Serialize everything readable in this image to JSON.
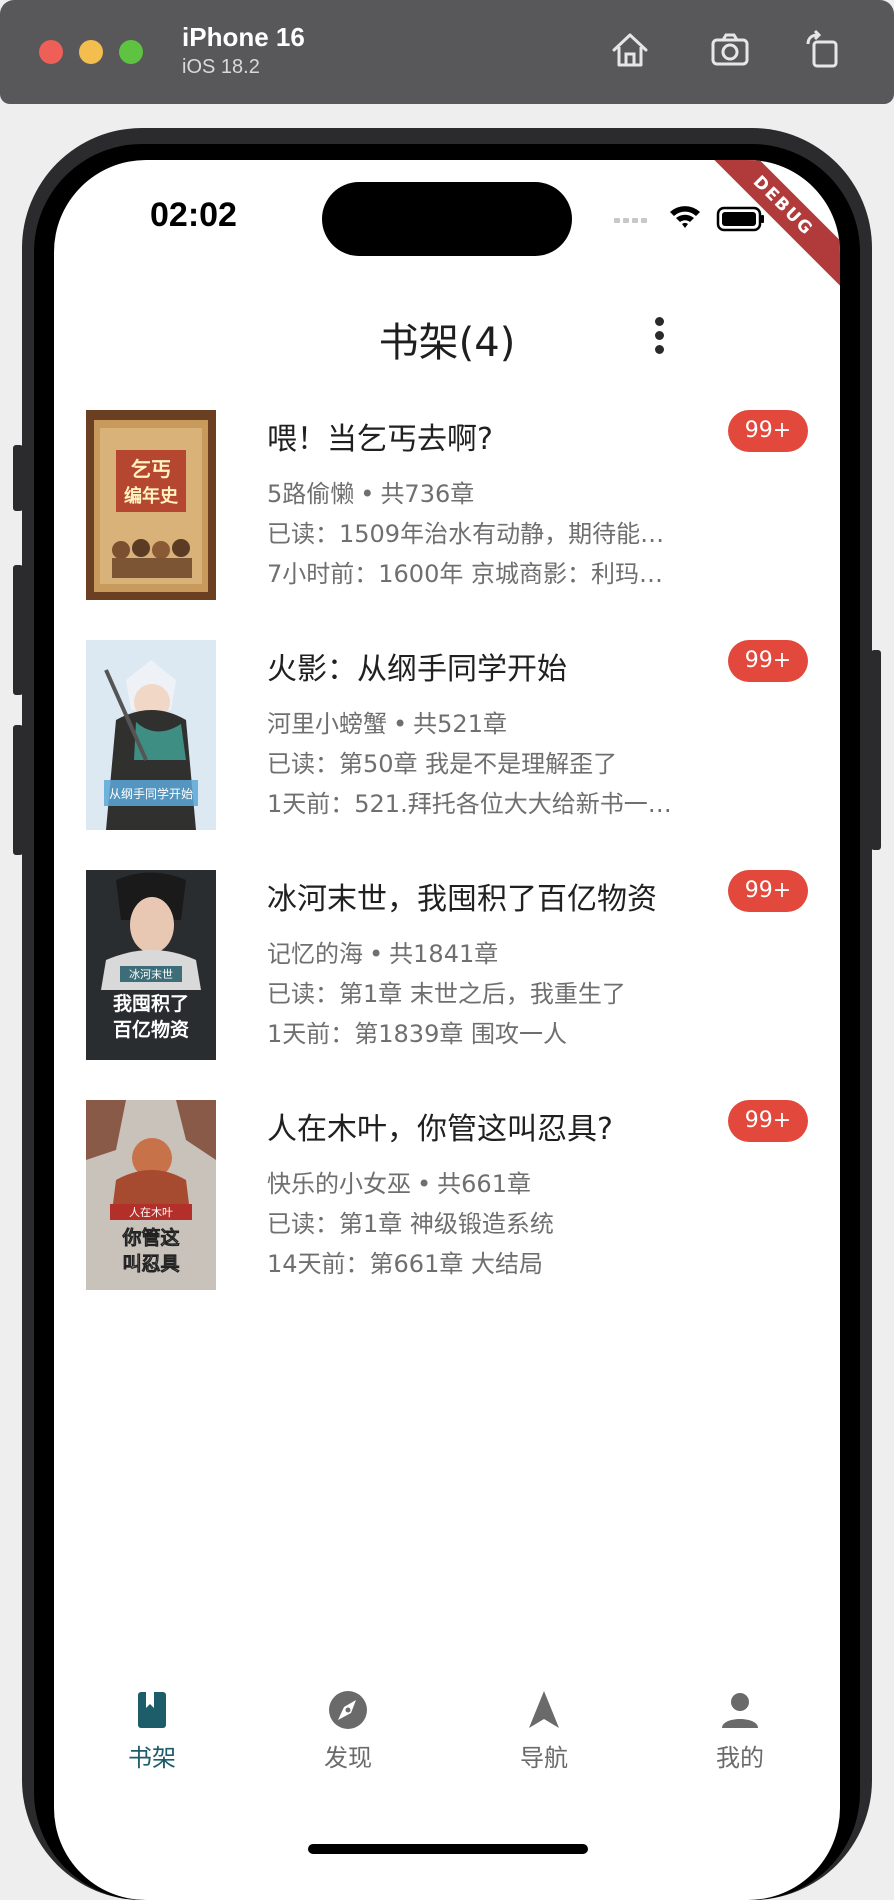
{
  "simulator": {
    "device_name": "iPhone 16",
    "os_version": "iOS 18.2",
    "tools": [
      "home-icon",
      "screenshot-icon",
      "rotate-icon"
    ]
  },
  "status_bar": {
    "time": "02:02",
    "debug_label": "DEBUG"
  },
  "app_bar": {
    "title": "书架(4)",
    "menu_icon": "more-vert-icon"
  },
  "books": [
    {
      "title": "喂！当乞丐去啊?",
      "author": "5路偷懒",
      "chapters": "共736章",
      "read": "已读：1509年治水有动静，期待能…",
      "update": "7小时前：1600年 京城商影：利玛…",
      "badge": "99+",
      "cover_text": "乞丐编年史"
    },
    {
      "title": "火影：从纲手同学开始",
      "author": "河里小螃蟹",
      "chapters": "共521章",
      "read": "已读：第50章 我是不是理解歪了",
      "update": "1天前：521.拜托各位大大给新书一…",
      "badge": "99+",
      "cover_text": "从纲手同学开始"
    },
    {
      "title": "冰河末世，我囤积了百亿物资",
      "author": "记忆的海",
      "chapters": "共1841章",
      "read": "已读：第1章 末世之后，我重生了",
      "update": "1天前：第1839章 围攻一人",
      "badge": "99+",
      "cover_text": "我囤积了百亿物资"
    },
    {
      "title": "人在木叶，你管这叫忍具?",
      "author": "快乐的小女巫",
      "chapters": "共661章",
      "read": "已读：第1章 神级锻造系统",
      "update": "14天前：第661章 大结局",
      "badge": "99+",
      "cover_text": "你管这叫忍具"
    }
  ],
  "bottom_nav": [
    {
      "label": "书架",
      "icon": "bookmark-book-icon",
      "active": true
    },
    {
      "label": "发现",
      "icon": "compass-icon",
      "active": false
    },
    {
      "label": "导航",
      "icon": "navigation-arrow-icon",
      "active": false
    },
    {
      "label": "我的",
      "icon": "person-icon",
      "active": false
    }
  ],
  "colors": {
    "accent": "#1d5d6a",
    "badge": "#e2493c",
    "debug_ribbon": "#b13b3b"
  }
}
